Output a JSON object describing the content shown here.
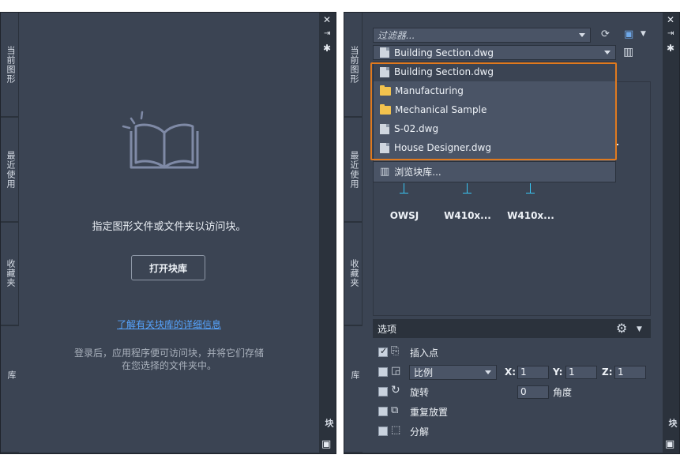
{
  "left_panel": {
    "tabs": [
      "当前图形",
      "最近使用",
      "收藏夹",
      "库"
    ],
    "message": "指定图形文件或文件夹以访问块。",
    "open_button": "打开块库",
    "learn_link": "了解有关块库的详细信息",
    "signin_note_line1": "登录后，应用程序便可访问块，并将它们存储",
    "signin_note_line2": "在您选择的文件夹中。",
    "rail_title": "块"
  },
  "right_panel": {
    "tabs": [
      "当前图形",
      "最近使用",
      "收藏夹",
      "库"
    ],
    "filter_placeholder": "过滤器...",
    "source_selected": "Building Section.dwg",
    "dropdown_items": [
      {
        "label": "Building Section.dwg",
        "icon": "dwg-file-icon"
      },
      {
        "label": "Manufacturing",
        "icon": "folder-icon"
      },
      {
        "label": "Mechanical Sample",
        "icon": "folder-icon"
      },
      {
        "label": "S-02.dwg",
        "icon": "dwg-file-icon"
      },
      {
        "label": "House Designer.dwg",
        "icon": "dwg-file-icon"
      }
    ],
    "browse_label": "浏览块库...",
    "blocks": [
      "OWSJ",
      "W410x...",
      "W410x..."
    ],
    "options_title": "选项",
    "options": {
      "insert_point": "插入点",
      "scale": "比例",
      "x_label": "X:",
      "x_value": "1",
      "y_label": "Y:",
      "y_value": "1",
      "z_label": "Z:",
      "z_value": "1",
      "rotation": "旋转",
      "angle_value": "0",
      "angle_label": "角度",
      "repeat": "重复放置",
      "explode": "分解"
    },
    "rail_title": "块"
  },
  "colors": {
    "panel_bg": "#3b4453",
    "field_bg": "#4a5466",
    "highlight_border": "#e07a1f",
    "link": "#56a4ff",
    "insertion_marker": "#39c6f4"
  }
}
